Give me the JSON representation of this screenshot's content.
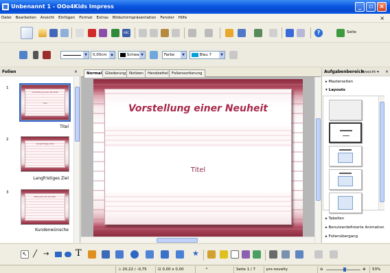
{
  "window": {
    "title": "Unbenannt 1 - OOo4Kids Impress",
    "minimize": "_",
    "maximize": "▫",
    "close": "×"
  },
  "menu": [
    "Datei",
    "Bearbeiten",
    "Ansicht",
    "Einfügen",
    "Format",
    "Extras",
    "Bildschirmpräsentation",
    "Fenster",
    "Hilfe"
  ],
  "toolbar": {
    "slide_button": "Seite"
  },
  "line_toolbar": {
    "width_value": "0,00cm",
    "line_color": "Schwarz",
    "fill_type": "Farbe",
    "fill_color": "Blau 7"
  },
  "slides_panel": {
    "title": "Folien",
    "slides": [
      {
        "number": "1",
        "title": "Vorstellung einer Neuheit",
        "sub": "Titel",
        "label": "Titel"
      },
      {
        "number": "2",
        "title": "Langfristiges Ziel",
        "sub": "",
        "label": "Langfristiges Ziel"
      },
      {
        "number": "3",
        "title": "Wünsche der Kunden",
        "sub": "",
        "label": "Kundenwünsche"
      }
    ]
  },
  "editor": {
    "tabs": [
      "Normal",
      "Gliederung",
      "Notizen",
      "Handzettel",
      "Foliensortierung"
    ],
    "active_tab": "Normal",
    "slide_title": "Vorstellung einer Neuheit",
    "slide_subtitle": "Titel"
  },
  "tasks_panel": {
    "title": "Aufgabenbereich",
    "view_menu": "Ansicht ▾",
    "sections": {
      "master": "Masterseiten",
      "layouts": "Layouts",
      "tables": "Tabellen",
      "animation": "Benutzerdefinierte Animation",
      "transition": "Folienübergang"
    }
  },
  "status": {
    "position": "20,22 / -0,75",
    "size": "0,00 x 0,00",
    "modified": "*",
    "page": "Seite 1 / 7",
    "theme": "prs-novelty",
    "zoom": "53%",
    "zoom_fraction": 0.53
  },
  "colors": {
    "titlebar": "#0a56e0",
    "accent": "#a8294a",
    "panel_bg": "#ffffff",
    "desktop": "#fdf7d7"
  }
}
